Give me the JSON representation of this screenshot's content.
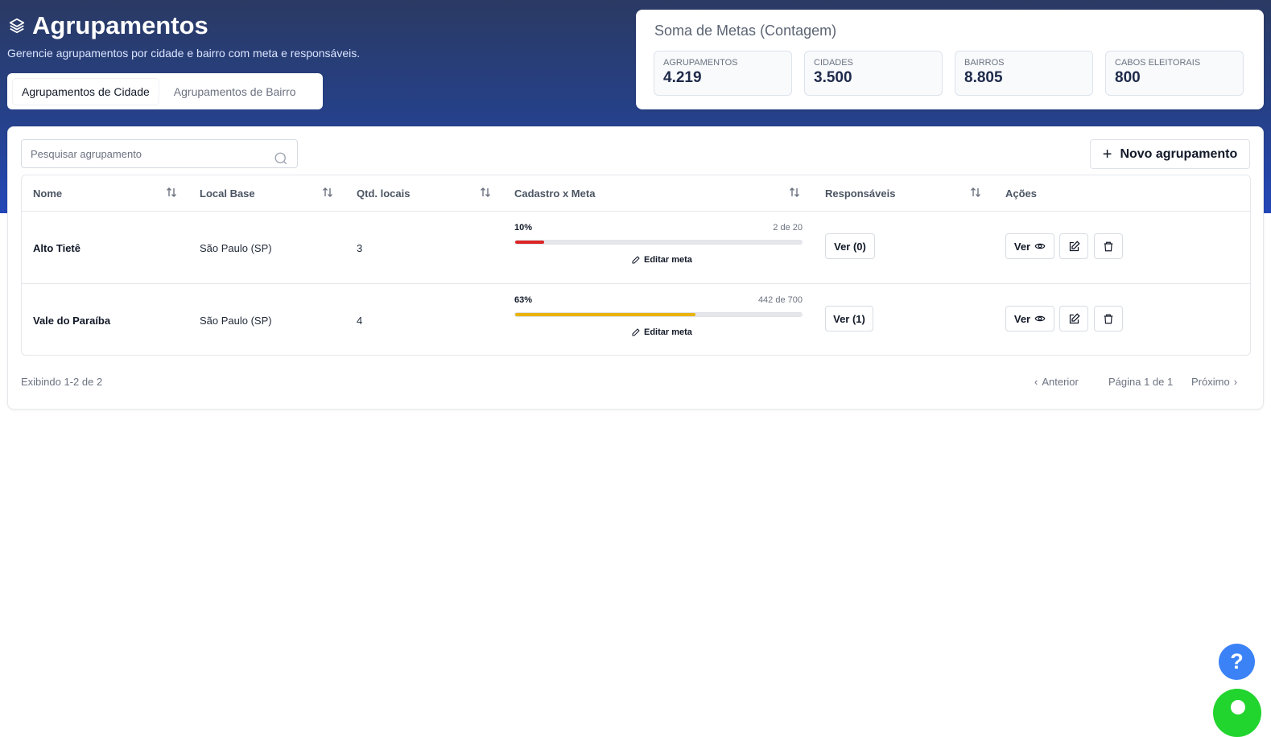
{
  "header": {
    "title": "Agrupamentos",
    "subtitle": "Gerencie agrupamentos por cidade e bairro com meta e responsáveis.",
    "tabs": [
      {
        "label": "Agrupamentos de Cidade",
        "active": true
      },
      {
        "label": "Agrupamentos de Bairro",
        "active": false
      }
    ]
  },
  "summary": {
    "title": "Soma de Metas (Contagem)",
    "stats": [
      {
        "label": "AGRUPAMENTOS",
        "value": "4.219"
      },
      {
        "label": "CIDADES",
        "value": "3.500"
      },
      {
        "label": "BAIRROS",
        "value": "8.805"
      },
      {
        "label": "CABOS ELEITORAIS",
        "value": "800"
      }
    ]
  },
  "toolbar": {
    "search_placeholder": "Pesquisar agrupamento",
    "new_label": "Novo agrupamento"
  },
  "table": {
    "columns": [
      "Nome",
      "Local Base",
      "Qtd. locais",
      "Cadastro x Meta",
      "Responsáveis",
      "Ações"
    ],
    "rows": [
      {
        "nome": "Alto Tietê",
        "local": "São Paulo (SP)",
        "qtd": "3",
        "pct": "10%",
        "ratio": "2 de 20",
        "progress": 0.1,
        "color": "#dc2626",
        "edit_label": "Editar meta",
        "resp": "Ver (0)",
        "ver": "Ver"
      },
      {
        "nome": "Vale do Paraíba",
        "local": "São Paulo (SP)",
        "qtd": "4",
        "pct": "63%",
        "ratio": "442 de 700",
        "progress": 0.63,
        "color": "#eab308",
        "edit_label": "Editar meta",
        "resp": "Ver (1)",
        "ver": "Ver"
      }
    ]
  },
  "footer": {
    "showing": "Exibindo 1-2 de 2",
    "prev": "Anterior",
    "page": "Página 1 de 1",
    "next": "Próximo"
  },
  "help_label": "?",
  "colors": {
    "accent": "#2347b8",
    "help": "#3b82f6",
    "chat": "#22d42e"
  }
}
